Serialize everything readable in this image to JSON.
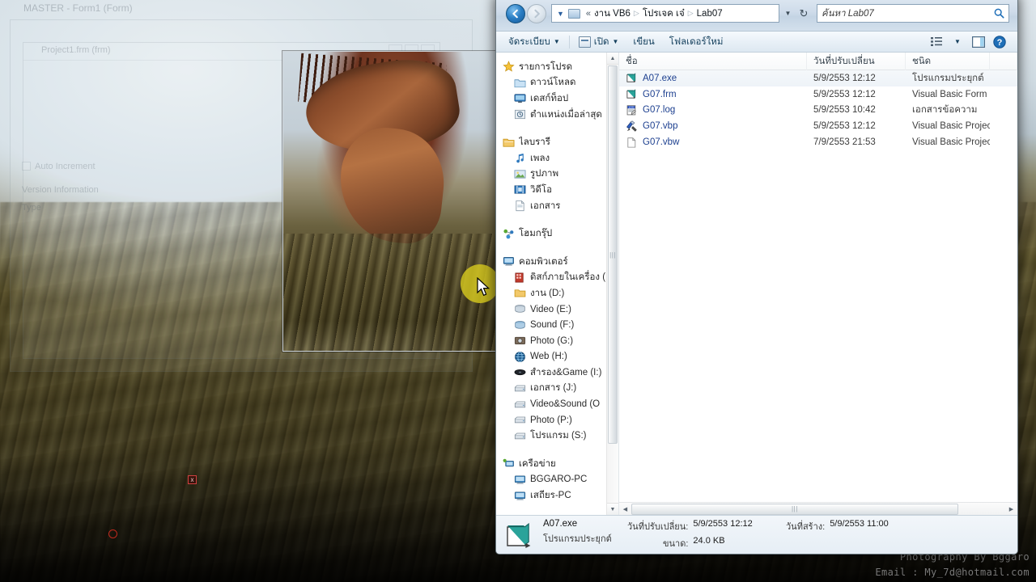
{
  "desktop": {
    "watermark_line1": "Photography By Bggaro",
    "watermark_line2": "Email : My_7d@hotmail.com",
    "ghost_window": {
      "outer_title": "MASTER - Form1 (Form)",
      "inner_title": "Project1.frm (frm)",
      "field_auto": "Auto Increment",
      "field_version": "Version Information",
      "field_type": "Type"
    },
    "marker_square": "x"
  },
  "explorer": {
    "nav": {
      "back_icon": "arrow-left-icon",
      "forward_icon": "arrow-right-icon",
      "dropdown_icon": "chevron-down-icon",
      "refresh_icon": "refresh-icon",
      "recent_icon": "recent-locations-icon"
    },
    "address": {
      "overflow": "«",
      "crumbs": [
        "งาน VB6",
        "โปรเจค เจ๋",
        "Lab07"
      ],
      "separator": "▷"
    },
    "search": {
      "placeholder": "ค้นหา Lab07",
      "icon": "search-icon"
    },
    "toolbar": {
      "organize": "จัดระเบียบ",
      "open": "เปิด",
      "burn": "เขียน",
      "new_folder": "โฟลเดอร์ใหม่",
      "caret": "▼",
      "view_icon": "view-options-icon",
      "preview_icon": "preview-pane-icon",
      "help_icon": "help-icon"
    },
    "sidebar": {
      "groups": [
        {
          "header": {
            "label": "รายการโปรด",
            "icon": "star-icon"
          },
          "items": [
            {
              "label": "ดาวน์โหลด",
              "icon": "downloads-icon"
            },
            {
              "label": "เดสก์ท็อป",
              "icon": "desktop-icon"
            },
            {
              "label": "ตำแหน่งเมื่อล่าสุด",
              "icon": "recent-places-icon"
            }
          ]
        },
        {
          "header": {
            "label": "ไลบรารี",
            "icon": "libraries-icon"
          },
          "items": [
            {
              "label": "เพลง",
              "icon": "music-icon"
            },
            {
              "label": "รูปภาพ",
              "icon": "pictures-icon"
            },
            {
              "label": "วิดีโอ",
              "icon": "videos-icon"
            },
            {
              "label": "เอกสาร",
              "icon": "documents-icon"
            }
          ]
        },
        {
          "header": {
            "label": "โฮมกรุ๊ป",
            "icon": "homegroup-icon"
          },
          "items": []
        },
        {
          "header": {
            "label": "คอมพิวเตอร์",
            "icon": "computer-icon"
          },
          "items": [
            {
              "label": "ดิสก์ภายในเครื่อง (",
              "icon": "local-disk-icon"
            },
            {
              "label": "งาน (D:)",
              "icon": "folder-drive-icon"
            },
            {
              "label": "Video (E:)",
              "icon": "drive-icon"
            },
            {
              "label": "Sound (F:)",
              "icon": "drive-icon"
            },
            {
              "label": "Photo (G:)",
              "icon": "drive-icon"
            },
            {
              "label": "Web (H:)",
              "icon": "globe-drive-icon"
            },
            {
              "label": "สำรอง&Game (I:)",
              "icon": "disc-icon"
            },
            {
              "label": "เอกสาร (J:)",
              "icon": "hdd-icon"
            },
            {
              "label": "Video&Sound (O",
              "icon": "hdd-icon"
            },
            {
              "label": "Photo (P:)",
              "icon": "hdd-icon"
            },
            {
              "label": "โปรแกรม (S:)",
              "icon": "hdd-icon"
            }
          ]
        },
        {
          "header": {
            "label": "เครือข่าย",
            "icon": "network-icon"
          },
          "items": [
            {
              "label": "BGGARO-PC",
              "icon": "pc-icon"
            },
            {
              "label": "เสถียร-PC",
              "icon": "pc-icon"
            }
          ]
        }
      ]
    },
    "columns": {
      "name": "ชื่อ",
      "date_modified": "วันที่ปรับเปลี่ยน",
      "type": "ชนิด",
      "size": ""
    },
    "files": [
      {
        "name": "A07.exe",
        "date": "5/9/2553 12:12",
        "type": "โปรแกรมประยุกต์",
        "icon": "application-icon",
        "selected": true
      },
      {
        "name": "G07.frm",
        "date": "5/9/2553 12:12",
        "type": "Visual Basic Form ...",
        "icon": "vb-form-icon",
        "selected": false
      },
      {
        "name": "G07.log",
        "date": "5/9/2553 10:42",
        "type": "เอกสารข้อความ",
        "icon": "text-log-icon",
        "selected": false
      },
      {
        "name": "G07.vbp",
        "date": "5/9/2553 12:12",
        "type": "Visual Basic Project",
        "icon": "vb-project-icon",
        "selected": false
      },
      {
        "name": "G07.vbw",
        "date": "7/9/2553 21:53",
        "type": "Visual Basic Projec...",
        "icon": "blank-file-icon",
        "selected": false
      }
    ],
    "details": {
      "name": "A07.exe",
      "kind": "โปรแกรมประยุกต์",
      "modified_label": "วันที่ปรับเปลี่ยน:",
      "modified_value": "5/9/2553 12:12",
      "size_label": "ขนาด:",
      "size_value": "24.0 KB",
      "created_label": "วันที่สร้าง:",
      "created_value": "5/9/2553 11:00",
      "icon": "application-icon"
    },
    "scrollbars": {
      "up_arrow": "▲",
      "down_arrow": "▼",
      "left_arrow": "◀",
      "right_arrow": "▶",
      "grip": "|||"
    }
  },
  "colors": {
    "link": "#1c3f8f",
    "accent": "#2a7ec4",
    "highlight": "#d6c81e",
    "toolbar_text": "#16415e"
  }
}
